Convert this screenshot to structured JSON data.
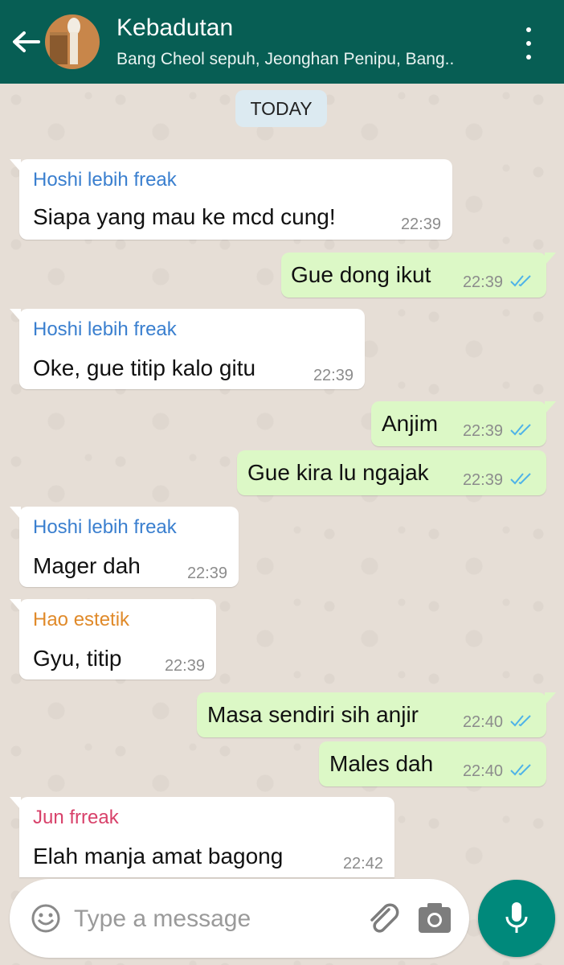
{
  "header": {
    "title": "Kebadutan",
    "subtitle": "Bang Cheol sepuh, Jeonghan Penipu, Bang.."
  },
  "date_chip": "TODAY",
  "colors": {
    "header": "#075e54",
    "incoming": "#ffffff",
    "outgoing": "#dcf8c6",
    "sender_hoshi": "#3a7fcf",
    "sender_hao": "#e08a2a",
    "sender_jun": "#d8416a",
    "read_ticks": "#4fb3e8",
    "mic_button": "#00897b"
  },
  "messages": [
    {
      "sender": "Hoshi lebih freak",
      "text": "Siapa yang mau ke mcd cung!",
      "time": "22:39"
    },
    {
      "text": "Gue dong ikut",
      "time": "22:39",
      "status": "read"
    },
    {
      "sender": "Hoshi lebih freak",
      "text": "Oke, gue titip kalo gitu",
      "time": "22:39"
    },
    {
      "text": "Anjim",
      "time": "22:39",
      "status": "read"
    },
    {
      "text": "Gue kira lu ngajak",
      "time": "22:39",
      "status": "read"
    },
    {
      "sender": "Hoshi lebih freak",
      "text": "Mager dah",
      "time": "22:39"
    },
    {
      "sender": "Hao estetik",
      "text": "Gyu, titip",
      "time": "22:39"
    },
    {
      "text": "Masa sendiri sih anjir",
      "time": "22:40",
      "status": "read"
    },
    {
      "text": "Males dah",
      "time": "22:40",
      "status": "read"
    },
    {
      "sender": "Jun frreak",
      "text": "Elah manja amat bagong",
      "time": "22:42"
    }
  ],
  "composer": {
    "placeholder": "Type a message",
    "icons": [
      "emoji-icon",
      "paperclip-icon",
      "camera-icon",
      "mic-icon"
    ]
  }
}
